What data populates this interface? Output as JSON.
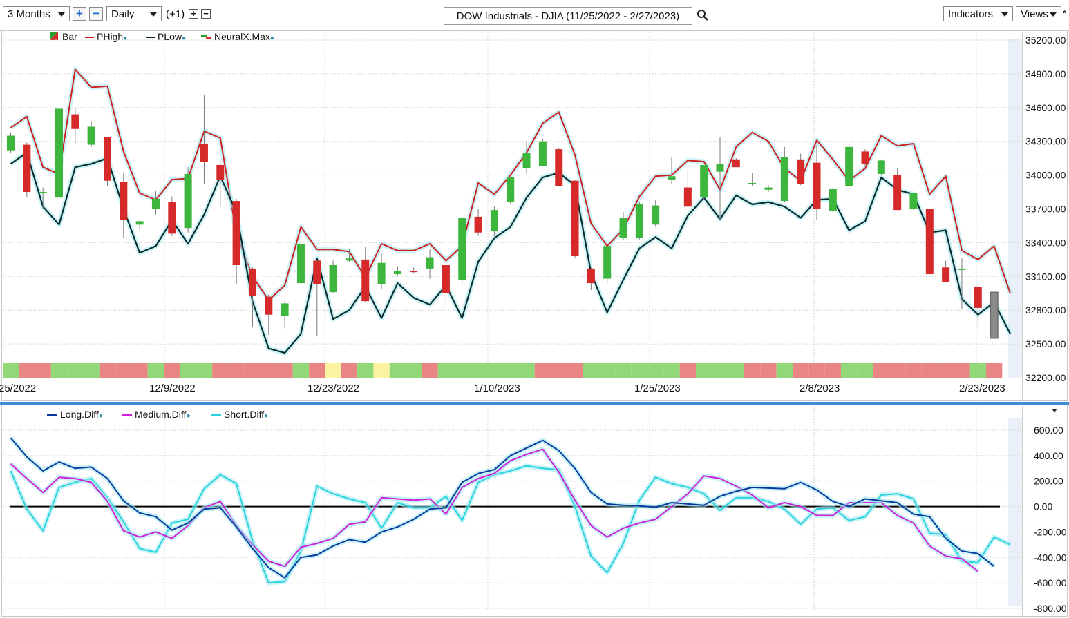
{
  "toolbar": {
    "range": "3 Months",
    "plus": "+",
    "minus": "−",
    "interval": "Daily",
    "offset": "(+1)",
    "offset_plus": "+",
    "offset_minus": "−",
    "title": "DOW Industrials - DJIA (11/25/2022 - 2/27/2023)",
    "indicators": "Indicators",
    "views": "Views",
    "views_extra": "*"
  },
  "price_legend": [
    {
      "label": "Bar",
      "color": "#2ca02c"
    },
    {
      "label": "PHigh",
      "color": "#d11f1f"
    },
    {
      "label": "PLow",
      "color": "#0b2a2e"
    },
    {
      "label": "NeuralX.Max",
      "color": "#d11f1f"
    }
  ],
  "osc_legend": [
    {
      "label": "Long.Diff",
      "color": "#0a3a9e"
    },
    {
      "label": "Medium.Diff",
      "color": "#d11fd8"
    },
    {
      "label": "Short.Diff",
      "color": "#27d3de"
    }
  ],
  "colors": {
    "up": "#3cb63c",
    "down": "#d62a2a",
    "phigh": "#d11f1f",
    "plow": "#0b2a2e",
    "long": "#0a3a9e",
    "medium": "#d11fd8",
    "short": "#27d3de",
    "band_green": "#90d878",
    "band_red": "#e98585",
    "band_yellow": "#fbf3a0"
  },
  "x_labels": [
    "25/2022",
    "12/9/2022",
    "12/23/2022",
    "1/10/2023",
    "1/25/2023",
    "2/8/2023",
    "2/23/2023"
  ],
  "price_axis_labels": [
    "35200.00",
    "34900.00",
    "34600.00",
    "34300.00",
    "34000.00",
    "33700.00",
    "33400.00",
    "33100.00",
    "32800.00",
    "32500.00",
    "32200.00"
  ],
  "osc_axis_labels": [
    "600.00",
    "400.00",
    "200.00",
    "0.00",
    "-200.00",
    "-400.00",
    "-600.00",
    "-800.00"
  ],
  "chart_data": [
    {
      "type": "candlestick",
      "title": "DOW Industrials - DJIA (11/25/2022 - 2/27/2023)",
      "ylim": [
        32200,
        35200
      ],
      "candles": [
        {
          "o": 34220,
          "h": 34380,
          "l": 34200,
          "c": 34350
        },
        {
          "o": 34270,
          "h": 34290,
          "l": 33800,
          "c": 33850
        },
        {
          "o": 33850,
          "h": 33890,
          "l": 33700,
          "c": 33850
        },
        {
          "o": 33800,
          "h": 34600,
          "l": 33790,
          "c": 34590
        },
        {
          "o": 34540,
          "h": 34600,
          "l": 34280,
          "c": 34410
        },
        {
          "o": 34270,
          "h": 34480,
          "l": 34250,
          "c": 34430
        },
        {
          "o": 34340,
          "h": 34340,
          "l": 33900,
          "c": 33950
        },
        {
          "o": 33940,
          "h": 34020,
          "l": 33440,
          "c": 33600
        },
        {
          "o": 33560,
          "h": 33600,
          "l": 33520,
          "c": 33590
        },
        {
          "o": 33700,
          "h": 33860,
          "l": 33650,
          "c": 33790
        },
        {
          "o": 33760,
          "h": 33810,
          "l": 33460,
          "c": 33480
        },
        {
          "o": 33530,
          "h": 34070,
          "l": 33490,
          "c": 34010
        },
        {
          "o": 34280,
          "h": 34710,
          "l": 33920,
          "c": 34120
        },
        {
          "o": 34090,
          "h": 34140,
          "l": 33720,
          "c": 33960
        },
        {
          "o": 33770,
          "h": 33790,
          "l": 33030,
          "c": 33200
        },
        {
          "o": 33170,
          "h": 33180,
          "l": 32650,
          "c": 32930
        },
        {
          "o": 32920,
          "h": 32940,
          "l": 32580,
          "c": 32760
        },
        {
          "o": 32750,
          "h": 32880,
          "l": 32640,
          "c": 32860
        },
        {
          "o": 33040,
          "h": 33440,
          "l": 33030,
          "c": 33390
        },
        {
          "o": 33240,
          "h": 33250,
          "l": 32570,
          "c": 33030
        },
        {
          "o": 32960,
          "h": 33240,
          "l": 32950,
          "c": 33200
        },
        {
          "o": 33240,
          "h": 33340,
          "l": 33230,
          "c": 33260
        },
        {
          "o": 33250,
          "h": 33360,
          "l": 32870,
          "c": 32880
        },
        {
          "o": 33030,
          "h": 33300,
          "l": 32990,
          "c": 33220
        },
        {
          "o": 33120,
          "h": 33190,
          "l": 33110,
          "c": 33150
        },
        {
          "o": 33150,
          "h": 33180,
          "l": 33130,
          "c": 33140
        },
        {
          "o": 33170,
          "h": 33340,
          "l": 33080,
          "c": 33270
        },
        {
          "o": 33200,
          "h": 33250,
          "l": 32850,
          "c": 32950
        },
        {
          "o": 33070,
          "h": 33630,
          "l": 33030,
          "c": 33620
        },
        {
          "o": 33630,
          "h": 33700,
          "l": 33460,
          "c": 33490
        },
        {
          "o": 33500,
          "h": 33720,
          "l": 33460,
          "c": 33690
        },
        {
          "o": 33760,
          "h": 33960,
          "l": 33740,
          "c": 33980
        },
        {
          "o": 34060,
          "h": 34300,
          "l": 34010,
          "c": 34200
        },
        {
          "o": 34080,
          "h": 34320,
          "l": 34080,
          "c": 34300
        },
        {
          "o": 34230,
          "h": 34240,
          "l": 33920,
          "c": 33900
        },
        {
          "o": 33950,
          "h": 33960,
          "l": 33260,
          "c": 33280
        },
        {
          "o": 33170,
          "h": 33180,
          "l": 32980,
          "c": 33040
        },
        {
          "o": 33080,
          "h": 33330,
          "l": 33040,
          "c": 33370
        },
        {
          "o": 33440,
          "h": 33670,
          "l": 33420,
          "c": 33620
        },
        {
          "o": 33440,
          "h": 33760,
          "l": 33430,
          "c": 33740
        },
        {
          "o": 33560,
          "h": 33780,
          "l": 33540,
          "c": 33730
        },
        {
          "o": 33960,
          "h": 34160,
          "l": 33920,
          "c": 33990
        },
        {
          "o": 33890,
          "h": 34050,
          "l": 33720,
          "c": 33720
        },
        {
          "o": 33800,
          "h": 34090,
          "l": 33780,
          "c": 34090
        },
        {
          "o": 34030,
          "h": 34340,
          "l": 33600,
          "c": 34100
        },
        {
          "o": 34140,
          "h": 34150,
          "l": 34070,
          "c": 34070
        },
        {
          "o": 33930,
          "h": 34020,
          "l": 33900,
          "c": 33930
        },
        {
          "o": 33870,
          "h": 33910,
          "l": 33850,
          "c": 33890
        },
        {
          "o": 33770,
          "h": 34250,
          "l": 33760,
          "c": 34160
        },
        {
          "o": 34140,
          "h": 34190,
          "l": 33910,
          "c": 33920
        },
        {
          "o": 34110,
          "h": 34270,
          "l": 33600,
          "c": 33700
        },
        {
          "o": 33680,
          "h": 33890,
          "l": 33660,
          "c": 33880
        },
        {
          "o": 33900,
          "h": 34270,
          "l": 33880,
          "c": 34250
        },
        {
          "o": 34210,
          "h": 34230,
          "l": 34080,
          "c": 34100
        },
        {
          "o": 34010,
          "h": 34140,
          "l": 34000,
          "c": 34130
        },
        {
          "o": 34000,
          "h": 34060,
          "l": 33690,
          "c": 33690
        },
        {
          "o": 33700,
          "h": 33840,
          "l": 33690,
          "c": 33840
        },
        {
          "o": 33700,
          "h": 33700,
          "l": 33120,
          "c": 33120
        },
        {
          "o": 33180,
          "h": 33240,
          "l": 33050,
          "c": 33050
        },
        {
          "o": 33170,
          "h": 33260,
          "l": 32810,
          "c": 33170
        },
        {
          "o": 33010,
          "h": 33040,
          "l": 32660,
          "c": 32820
        },
        {
          "o": 32550,
          "h": 32960,
          "l": 32540,
          "c": 32960
        }
      ],
      "phigh": [
        34420,
        34520,
        34070,
        34010,
        34940,
        34780,
        34790,
        34210,
        33840,
        33780,
        33960,
        33970,
        34390,
        34330,
        33480,
        33100,
        32890,
        33020,
        33540,
        33340,
        33340,
        33320,
        33090,
        33390,
        33330,
        33330,
        33390,
        33240,
        33370,
        33930,
        33830,
        34000,
        34200,
        34460,
        34560,
        34180,
        33570,
        33370,
        33520,
        33810,
        33990,
        34000,
        34130,
        34120,
        33870,
        34250,
        34380,
        34300,
        34060,
        33950,
        34310,
        34140,
        33950,
        34060,
        34350,
        34260,
        34280,
        33830,
        33990,
        33330,
        33250,
        33370,
        32950
      ],
      "plow": [
        34100,
        34200,
        33720,
        33560,
        34070,
        34100,
        34150,
        33700,
        33310,
        33370,
        33600,
        33390,
        33650,
        33990,
        33670,
        32880,
        32460,
        32420,
        32590,
        33260,
        32720,
        32800,
        33010,
        32730,
        33040,
        32910,
        32850,
        33020,
        32730,
        33230,
        33440,
        33540,
        33800,
        33980,
        34020,
        33910,
        33130,
        32780,
        33070,
        33350,
        33450,
        33350,
        33640,
        33800,
        33610,
        33820,
        33740,
        33760,
        33720,
        33620,
        33780,
        33790,
        33510,
        33590,
        33980,
        33870,
        33830,
        33490,
        33510,
        32900,
        32760,
        32870,
        32590
      ]
    },
    {
      "type": "line",
      "ylim": [
        -800,
        700
      ],
      "series": [
        {
          "name": "Long.Diff",
          "values": [
            540,
            390,
            280,
            350,
            300,
            310,
            220,
            45,
            -50,
            -80,
            -185,
            -130,
            -20,
            -10,
            -160,
            -330,
            -480,
            -560,
            -400,
            -380,
            -310,
            -260,
            -280,
            -200,
            -160,
            -100,
            -20,
            -10,
            190,
            260,
            290,
            400,
            460,
            520,
            440,
            300,
            110,
            20,
            10,
            5,
            -5,
            30,
            20,
            10,
            80,
            120,
            150,
            145,
            140,
            190,
            130,
            40,
            0,
            60,
            45,
            30,
            -60,
            -80,
            -250,
            -350,
            -370,
            -470
          ]
        },
        {
          "name": "Medium.Diff",
          "values": [
            335,
            220,
            110,
            230,
            220,
            190,
            40,
            -190,
            -240,
            -200,
            -250,
            -150,
            -10,
            40,
            -150,
            -300,
            -430,
            -470,
            -320,
            -290,
            -250,
            -140,
            -120,
            70,
            60,
            50,
            60,
            -60,
            150,
            220,
            260,
            360,
            410,
            450,
            270,
            50,
            -150,
            -240,
            -170,
            -130,
            -100,
            0,
            100,
            240,
            220,
            160,
            90,
            -10,
            30,
            0,
            -70,
            -70,
            30,
            30,
            30,
            -70,
            -130,
            -310,
            -390,
            -410,
            -510
          ]
        },
        {
          "name": "Short.Diff",
          "values": [
            280,
            -20,
            -190,
            150,
            190,
            220,
            70,
            -120,
            -330,
            -360,
            -130,
            -100,
            140,
            250,
            180,
            -270,
            -600,
            -590,
            -350,
            160,
            100,
            60,
            30,
            -170,
            30,
            -10,
            -10,
            80,
            -110,
            190,
            250,
            280,
            320,
            300,
            290,
            0,
            -390,
            -520,
            -290,
            50,
            230,
            180,
            150,
            100,
            -30,
            70,
            70,
            40,
            -20,
            -140,
            -20,
            -10,
            -110,
            -80,
            90,
            100,
            60,
            -210,
            -220,
            -430,
            -440,
            -240,
            -300
          ]
        }
      ]
    }
  ]
}
